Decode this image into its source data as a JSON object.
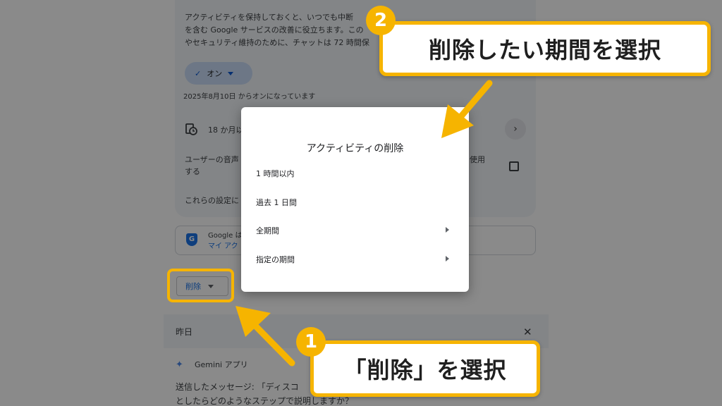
{
  "background": {
    "intro_line1": "アクティビティを保持しておくと、いつでも中断",
    "intro_line2": "を含む Google サービスの改善に役立ちます。この",
    "intro_line3": "やセキュリティ維持のために、チャットは 72 時間保",
    "toggle_chip_label": "オン",
    "on_since_text": "2025年8月10日 からオンになっています",
    "auto_delete_label": "18 か月以",
    "voice_line1": "ユーザーの音声",
    "voice_line2": "する",
    "voice_suffix": "使用",
    "settings_text": "これらの設定に",
    "google_card_line1": "Google は",
    "google_card_line2": "マイ アク",
    "google_shield_letter": "G",
    "delete_button_label": "削除",
    "day_header": "昨日",
    "close_glyph": "✕",
    "app_name": "Gemini アプリ",
    "message_line1": "送信したメッセージ: 「ディスコ",
    "message_line2": "としたらどのようなステップで説明しますか？"
  },
  "dialog": {
    "title": "アクティビティの削除",
    "items": [
      {
        "label": "1 時間以内",
        "has_submenu": false
      },
      {
        "label": "過去 1 日間",
        "has_submenu": false
      },
      {
        "label": "全期間",
        "has_submenu": true
      },
      {
        "label": "指定の期間",
        "has_submenu": true
      }
    ]
  },
  "annotations": {
    "step1_number": "1",
    "step1_text": "「削除」を選択",
    "step2_number": "2",
    "step2_text": "削除したい期間を選択",
    "accent_color": "#f6b400"
  }
}
